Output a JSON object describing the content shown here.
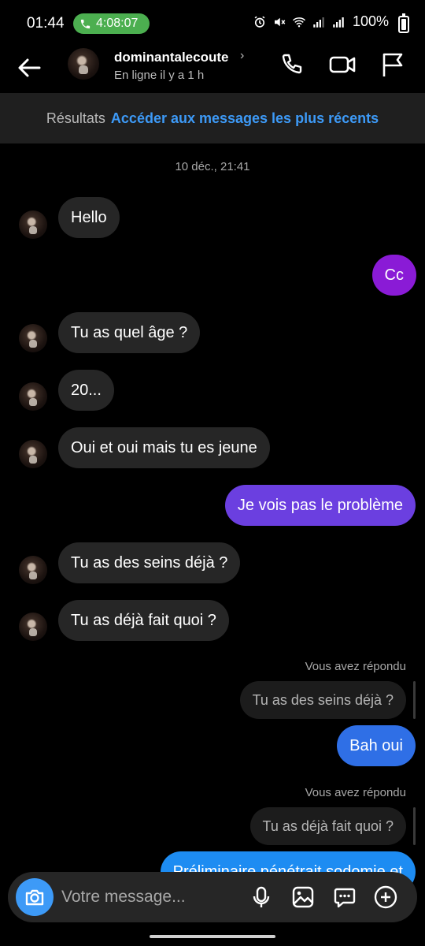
{
  "status_bar": {
    "time": "01:44",
    "call_duration": "4:08:07",
    "battery_percent": "100%",
    "call_color": "#4caf50"
  },
  "header": {
    "username": "dominantalecoute",
    "presence": "En ligne il y a 1 h",
    "icons": [
      "back-arrow-icon",
      "phone-icon",
      "video-camera-icon",
      "flag-icon"
    ]
  },
  "results_banner": {
    "label": "Résultats",
    "link": "Accéder aux messages les plus récents"
  },
  "conversation": {
    "date": "10 déc., 21:41",
    "messages": [
      {
        "from": "them",
        "text": "Hello"
      },
      {
        "from": "me",
        "text": "Cc"
      },
      {
        "from": "them",
        "text": "Tu as quel âge ?"
      },
      {
        "from": "them",
        "text": "20..."
      },
      {
        "from": "them",
        "text": "Oui et oui mais tu es jeune"
      },
      {
        "from": "me",
        "text": "Je vois pas le problème"
      },
      {
        "from": "them",
        "text": "Tu as des seins déjà ?"
      },
      {
        "from": "them",
        "text": "Tu as déjà fait quoi ?"
      }
    ],
    "replies": [
      {
        "label": "Vous avez répondu",
        "quoted": "Tu as des seins déjà ?",
        "text": "Bah oui"
      },
      {
        "label": "Vous avez répondu",
        "quoted": "Tu as déjà fait quoi ?",
        "text": "Préliminaire pénétrait sodomie et"
      }
    ]
  },
  "composer": {
    "placeholder": "Votre message..."
  },
  "colors": {
    "accent": "#3d9af7",
    "incoming_bubble": "#262626",
    "outgoing_purple": "#8a2be2"
  }
}
